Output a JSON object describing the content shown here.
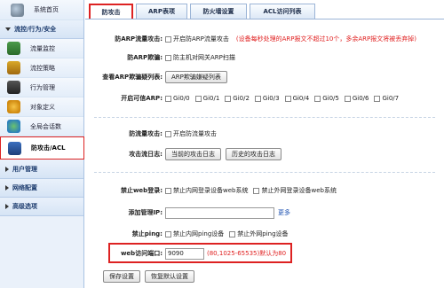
{
  "sidebar": {
    "top_item": "系统首页",
    "group_open": "流控/行为/安全",
    "items": [
      {
        "label": "流量监控",
        "icon": "monitor-icon"
      },
      {
        "label": "流控策略",
        "icon": "strategy-icon"
      },
      {
        "label": "行为管理",
        "icon": "manage-icon"
      },
      {
        "label": "对象定义",
        "icon": "object-icon"
      },
      {
        "label": "全局会话数",
        "icon": "session-icon"
      },
      {
        "label": "防攻击/ACL",
        "icon": "shield-icon"
      }
    ],
    "groups_closed": [
      "用户管理",
      "网络配置",
      "高级选项"
    ]
  },
  "tabs": [
    "防攻击",
    "ARP表项",
    "防火墙设置",
    "ACL访问列表"
  ],
  "arp": {
    "flow_label": "防ARP流量攻击:",
    "flow_opt": "开启防ARP流量攻击",
    "flow_note": "(设备每秒处理的ARP报文不超过10个，多余ARP报文将被丢弃掉)",
    "spoof_label": "防ARP欺骗:",
    "spoof_opt": "防主机对网关ARP扫描",
    "suspect_label": "查看ARP欺骗疑列表:",
    "suspect_btn": "ARP欺骗嫌疑列表",
    "trust_label": "开启可信ARP:",
    "trust_opts": [
      "Gi0/0",
      "Gi0/1",
      "Gi0/2",
      "Gi0/3",
      "Gi0/4",
      "Gi0/5",
      "Gi0/6",
      "Gi0/7"
    ]
  },
  "flood": {
    "label": "防流量攻击:",
    "opt": "开启防流量攻击",
    "log_label": "攻击流日志:",
    "log_btn_current": "当前的攻击日志",
    "log_btn_history": "历史的攻击日志"
  },
  "web": {
    "login_label": "禁止web登录:",
    "login_opt_in": "禁止内网登录设备web系统",
    "login_opt_out": "禁止外网登录设备web系统",
    "admin_label": "添加管理IP:",
    "admin_value": "",
    "more": "更多",
    "ping_label": "禁止ping:",
    "ping_opt_in": "禁止内网ping设备",
    "ping_opt_out": "禁止外网ping设备",
    "port_label": "web访问端口:",
    "port_value": "9090",
    "port_note": "(80,1025-65535)默认为80"
  },
  "buttons": {
    "save": "保存设置",
    "restore": "恢复默认设置"
  }
}
